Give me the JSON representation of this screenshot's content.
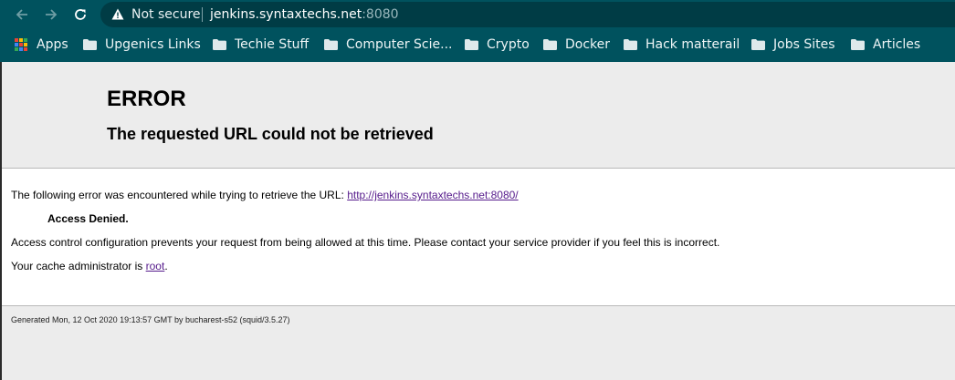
{
  "browser": {
    "security_label": "Not secure",
    "url_host": "jenkins.syntaxtechs.net",
    "url_port": ":8080",
    "toolbar_color": "#00525e",
    "bookmarks": [
      {
        "label": "Apps",
        "icon": "apps-grid-icon"
      },
      {
        "label": "Upgenics Links",
        "icon": "folder-icon"
      },
      {
        "label": "Techie Stuff",
        "icon": "folder-icon"
      },
      {
        "label": "Computer Scie...",
        "icon": "folder-icon"
      },
      {
        "label": "Crypto",
        "icon": "folder-icon"
      },
      {
        "label": "Docker",
        "icon": "folder-icon"
      },
      {
        "label": "Hack matterail",
        "icon": "folder-icon"
      },
      {
        "label": "Jobs Sites",
        "icon": "folder-icon"
      },
      {
        "label": "Articles",
        "icon": "folder-icon"
      }
    ]
  },
  "error_page": {
    "title": "ERROR",
    "subtitle": "The requested URL could not be retrieved",
    "intro": "The following error was encountered while trying to retrieve the URL: ",
    "url_link": "http://jenkins.syntaxtechs.net:8080/",
    "denied": "Access Denied.",
    "explanation": "Access control configuration prevents your request from being allowed at this time. Please contact your service provider if you feel this is incorrect.",
    "cache_admin_prefix": "Your cache administrator is ",
    "cache_admin_link": "root",
    "cache_admin_suffix": ".",
    "footer": "Generated Mon, 12 Oct 2020 19:13:57 GMT by bucharest-s52 (squid/3.5.27)"
  }
}
